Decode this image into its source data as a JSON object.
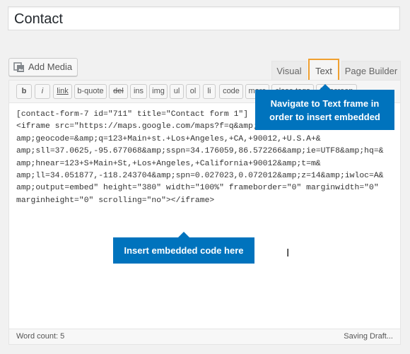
{
  "post": {
    "title": "Contact"
  },
  "media": {
    "add_media_label": "Add Media",
    "icon": "media-icon"
  },
  "tabs": {
    "visual": "Visual",
    "text": "Text",
    "page_builder": "Page Builder"
  },
  "toolbar": {
    "buttons": [
      "b",
      "i",
      "link",
      "b-quote",
      "del",
      "ins",
      "img",
      "ul",
      "ol",
      "li",
      "code",
      "more",
      "close tags",
      "fullscreen"
    ]
  },
  "content": {
    "lines": [
      "[contact-form-7 id=\"711\" title=\"Contact form 1\"]",
      "",
      "<iframe src=\"https://maps.google.com/maps?f=q&amp;source=s_q&amp;hl=en&",
      "amp;geocode=&amp;q=123+Main+st.+Los+Angeles,+CA,+90012,+U.S.A+&",
      "amp;sll=37.0625,-95.677068&amp;sspn=34.176059,86.572266&amp;ie=UTF8&amp;hq=&",
      "amp;hnear=123+S+Main+St,+Los+Angeles,+California+90012&amp;t=m&",
      "amp;ll=34.051877,-118.243704&amp;spn=0.027023,0.072012&amp;z=14&amp;iwloc=A&",
      "amp;output=embed\" height=\"380\" width=\"100%\" frameborder=\"0\" marginwidth=\"0\"",
      "marginheight=\"0\" scrolling=\"no\"></iframe>"
    ]
  },
  "status": {
    "word_count": "Word count: 5",
    "saving": "Saving Draft..."
  },
  "callouts": {
    "text_frame": "Navigate to Text frame in order to insert embedded",
    "insert_code": "Insert embedded code here"
  },
  "colors": {
    "callout_bg": "#0073bd",
    "tab_highlight": "#f0a030"
  }
}
